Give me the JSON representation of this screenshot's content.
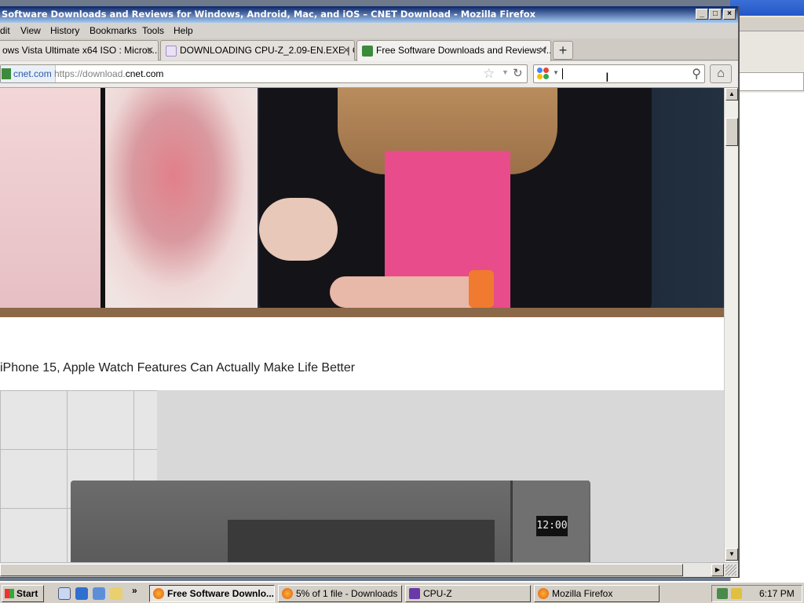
{
  "window": {
    "title": "Software Downloads and Reviews for Windows, Android, Mac, and iOS – CNET Download - Mozilla Firefox"
  },
  "menu": [
    "dit",
    "View",
    "History",
    "Bookmarks",
    "Tools",
    "Help"
  ],
  "tabs": [
    {
      "label": "ows Vista Ultimate x64 ISO : Micros..."
    },
    {
      "label": "DOWNLOADING CPU-Z_2.09-EN.EXE | C..."
    },
    {
      "label": "Free Software Downloads and Reviews f..."
    }
  ],
  "newtab_label": "+",
  "urlbar": {
    "identity": "cnet.com",
    "prefix": "https://download.",
    "domain": "cnet.com"
  },
  "content": {
    "caption": "iPhone 15, Apple Watch Features Can Actually Make Life Better",
    "clock_display": "12:00"
  },
  "taskbar": {
    "start": "Start",
    "buttons": [
      {
        "label": "Free Software Downlo...",
        "active": true
      },
      {
        "label": "5% of 1 file - Downloads",
        "active": false
      },
      {
        "label": "CPU-Z",
        "active": false
      },
      {
        "label": "Mozilla Firefox",
        "active": false
      }
    ],
    "time": "6:17 PM"
  },
  "icons": {
    "minimize": "minimize-icon",
    "maximize": "maximize-icon",
    "close": "close-icon",
    "star": "star-icon",
    "reload": "reload-icon",
    "search": "search-icon",
    "home": "home-icon"
  },
  "colors": {
    "titlebar": "#0a246a",
    "active_tab_favicon": "#3c8b3c",
    "shirt": "#e84c8a",
    "watch_band": "#f07a30"
  }
}
